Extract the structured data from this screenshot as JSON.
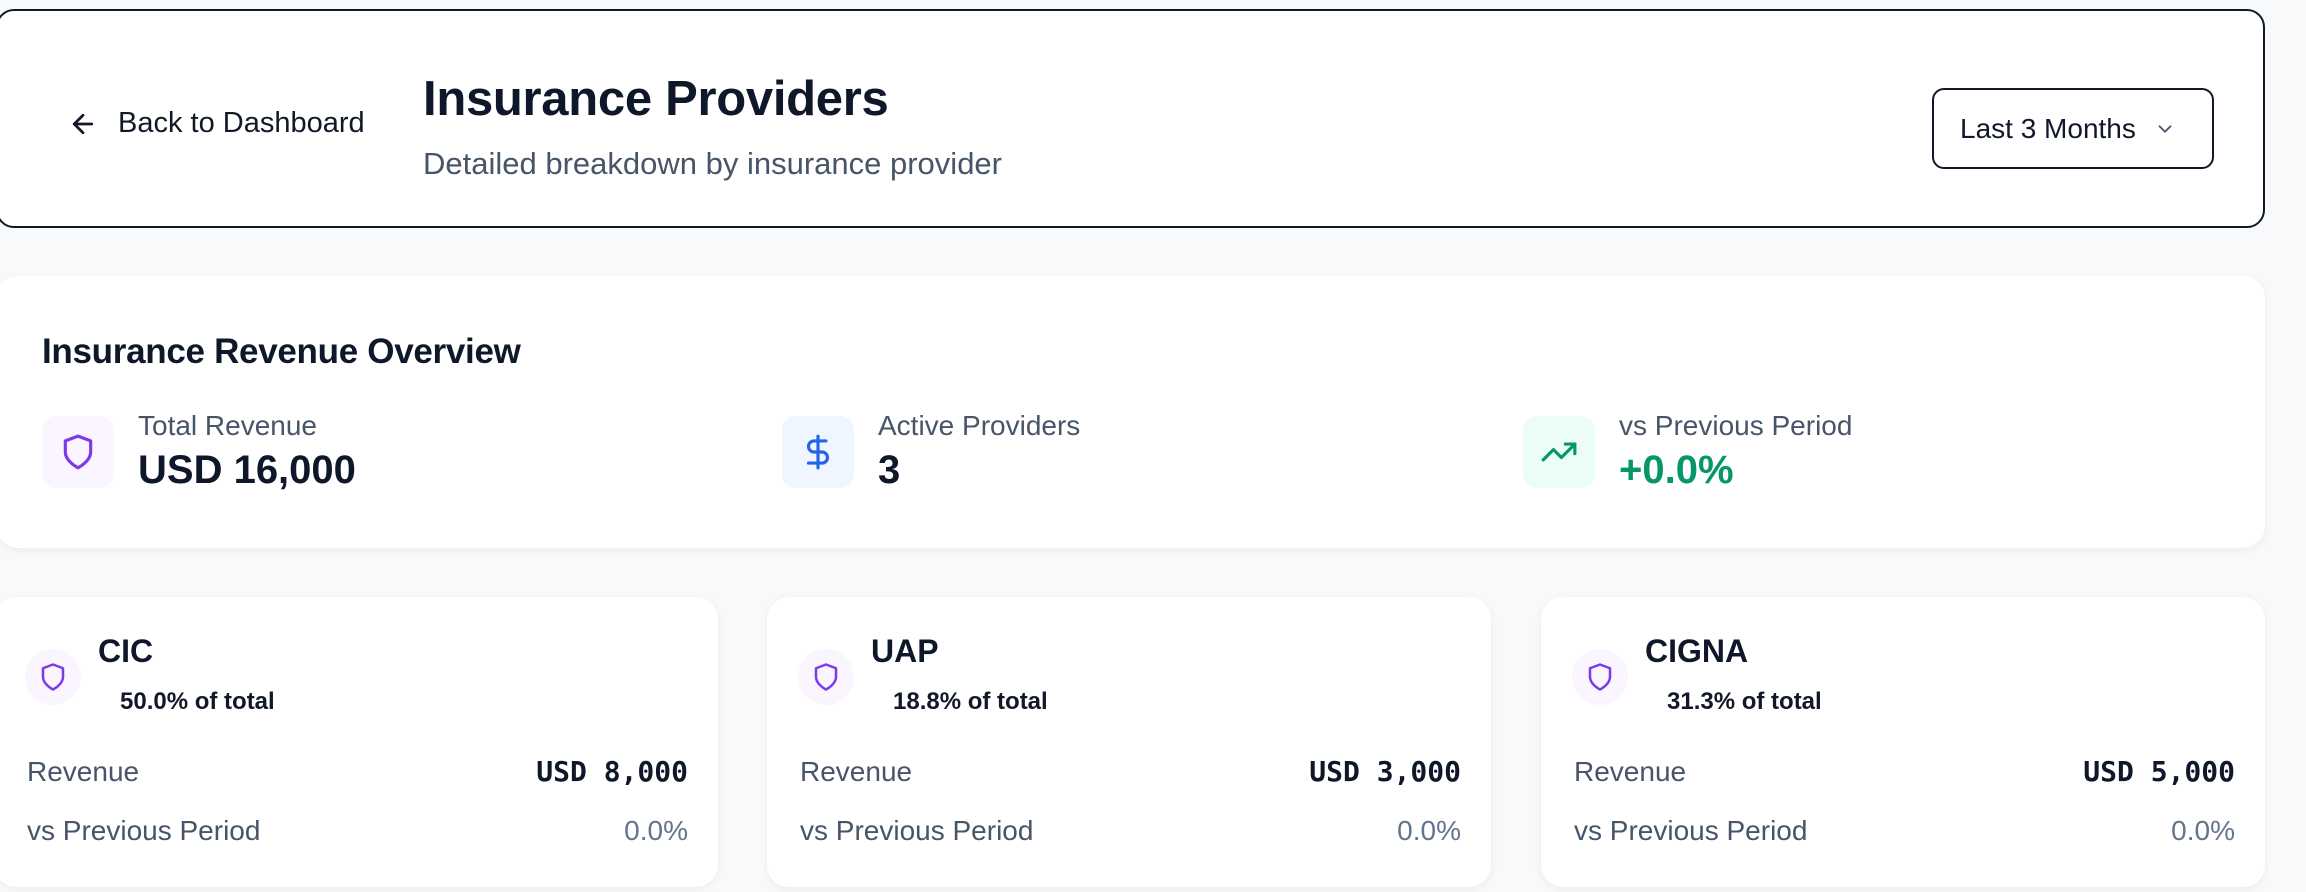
{
  "header": {
    "back_label": "Back to Dashboard",
    "title": "Insurance Providers",
    "subtitle": "Detailed breakdown by insurance provider",
    "period_select": "Last 3 Months"
  },
  "overview": {
    "title": "Insurance Revenue Overview",
    "metrics": [
      {
        "label": "Total Revenue",
        "value": "USD 16,000",
        "icon": "shield-icon",
        "accent": "#7c3aed"
      },
      {
        "label": "Active Providers",
        "value": "3",
        "icon": "dollar-icon",
        "accent": "#2563eb"
      },
      {
        "label": "vs Previous Period",
        "value": "+0.0%",
        "icon": "trending-up-icon",
        "accent": "#059669"
      }
    ]
  },
  "providers": [
    {
      "name": "CIC",
      "share": "50.0% of total",
      "revenue_label": "Revenue",
      "revenue": "USD 8,000",
      "change_label": "vs Previous Period",
      "change": "0.0%"
    },
    {
      "name": "UAP",
      "share": "18.8% of total",
      "revenue_label": "Revenue",
      "revenue": "USD 3,000",
      "change_label": "vs Previous Period",
      "change": "0.0%"
    },
    {
      "name": "CIGNA",
      "share": "31.3% of total",
      "revenue_label": "Revenue",
      "revenue": "USD 5,000",
      "change_label": "vs Previous Period",
      "change": "0.0%"
    }
  ]
}
